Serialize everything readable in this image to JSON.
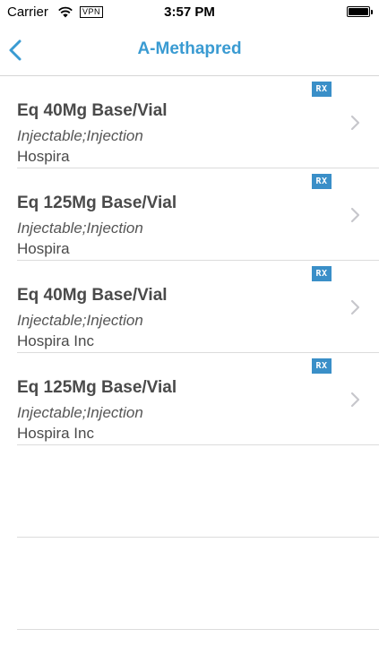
{
  "status_bar": {
    "carrier": "Carrier",
    "vpn": "VPN",
    "time": "3:57 PM",
    "wifi_icon": "wifi-icon",
    "battery_level": 1.0
  },
  "nav": {
    "back_icon": "chevron-left-icon",
    "title": "A-Methapred"
  },
  "accent_color": "#3a9bd2",
  "items": [
    {
      "badge": "RX",
      "title": "Eq 40Mg Base/Vial",
      "form": "Injectable;Injection",
      "company": "Hospira"
    },
    {
      "badge": "RX",
      "title": "Eq 125Mg Base/Vial",
      "form": "Injectable;Injection",
      "company": "Hospira"
    },
    {
      "badge": "RX",
      "title": "Eq 40Mg Base/Vial",
      "form": "Injectable;Injection",
      "company": "Hospira Inc"
    },
    {
      "badge": "RX",
      "title": "Eq 125Mg Base/Vial",
      "form": "Injectable;Injection",
      "company": "Hospira Inc"
    }
  ]
}
